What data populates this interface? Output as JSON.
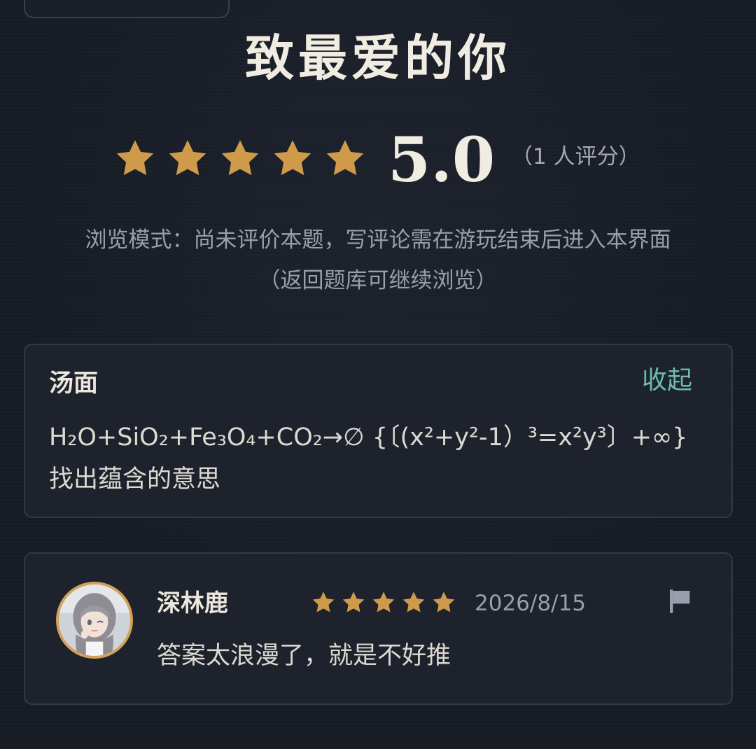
{
  "header": {
    "title": "致最爱的你"
  },
  "rating": {
    "stars": 5,
    "star_color": "#cf9a4a",
    "score": "5.0",
    "count_label": "（1 人评分）"
  },
  "browse_mode": {
    "line1": "浏览模式：尚未评价本题，写评论需在游玩结束后进入本界面",
    "line2": "（返回题库可继续浏览）"
  },
  "puzzle": {
    "label": "汤面",
    "collapse_label": "收起",
    "text": "H₂O+SiO₂+Fe₃O₄+CO₂→∅ {〔(x²+y²-1）³=x²y³〕+∞} 找出蕴含的意思"
  },
  "comments": [
    {
      "username": "深林鹿",
      "stars": 5,
      "date": "2026/8/15",
      "text": "答案太浪漫了，就是不好推",
      "avatar_icon": "avatar-anime-girl",
      "report_icon": "flag-icon"
    }
  ],
  "colors": {
    "background": "#171b24",
    "card": "#1d222d",
    "accent_teal": "#6dbca8",
    "avatar_ring": "#d2a15a"
  }
}
